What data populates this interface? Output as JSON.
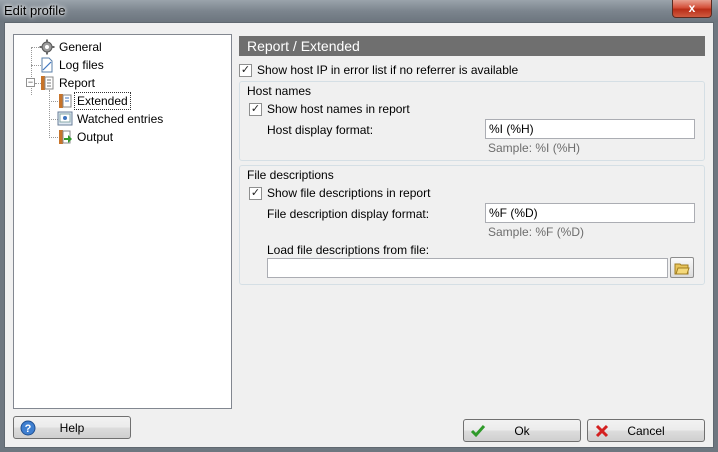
{
  "window": {
    "title": "Edit profile",
    "close_glyph": "x"
  },
  "tree": {
    "items": [
      {
        "label": "General",
        "icon": "gear-icon"
      },
      {
        "label": "Log files",
        "icon": "document-icon"
      },
      {
        "label": "Report",
        "icon": "report-icon",
        "expanded": true
      },
      {
        "label": "Extended",
        "icon": "report-page-icon",
        "selected": true
      },
      {
        "label": "Watched entries",
        "icon": "watched-entries-icon"
      },
      {
        "label": "Output",
        "icon": "output-icon"
      }
    ],
    "expander_glyph": "−"
  },
  "panel": {
    "header": "Report / Extended",
    "show_host_ip": {
      "label": "Show host IP in error list if no referrer is available",
      "checked": true
    },
    "host_names": {
      "title": "Host names",
      "show_host_names": {
        "label": "Show host names in report",
        "checked": true
      },
      "format_label": "Host display format:",
      "format_value": "%I (%H)",
      "sample": "Sample: %I (%H)"
    },
    "file_descriptions": {
      "title": "File descriptions",
      "show_file_desc": {
        "label": "Show file descriptions in report",
        "checked": true
      },
      "format_label": "File description display format:",
      "format_value": "%F (%D)",
      "sample": "Sample: %F (%D)",
      "load_label": "Load file descriptions from file:",
      "load_value": ""
    },
    "check_glyph": "✓"
  },
  "buttons": {
    "help": "Help",
    "ok": "Ok",
    "cancel": "Cancel"
  },
  "colors": {
    "panel_header_bg": "#6f6f6f",
    "ok_icon": "#2f9a2a",
    "cancel_icon": "#d42020",
    "help_icon": "#2f6fc0"
  }
}
